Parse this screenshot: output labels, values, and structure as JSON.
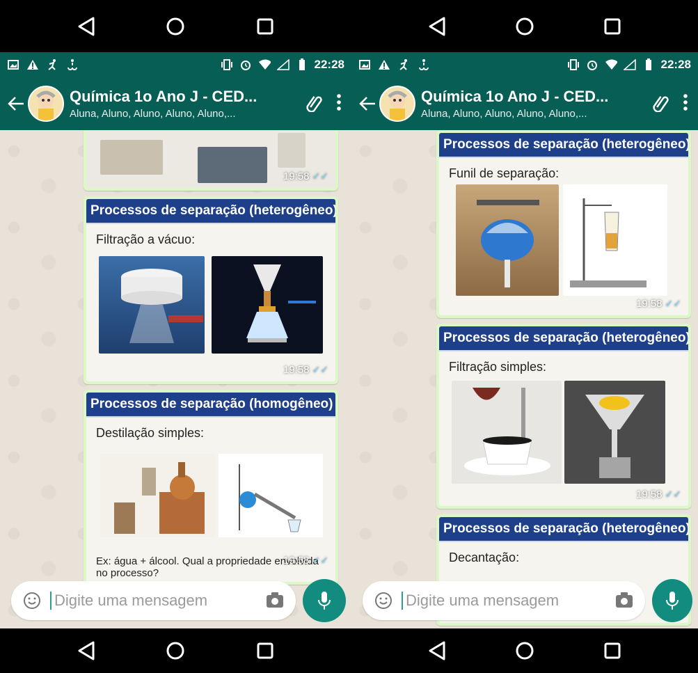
{
  "status": {
    "time": "22:28"
  },
  "header": {
    "title": "Química 1o Ano J - CED...",
    "subtitle": "Aluna, Aluno, Aluno, Aluno, Aluno,..."
  },
  "left": {
    "messages": [
      {
        "time": "19:58"
      },
      {
        "slide_title": "Processos de separação (heterogêneo)",
        "slide_sub": "Filtração a vácuo:",
        "time": "19:58"
      },
      {
        "slide_title": "Processos de separação (homogêneo)",
        "slide_sub": "Destilação simples:",
        "slide_foot": "Ex: água + álcool. Qual a propriedade envolvida no processo?",
        "time": "19:58"
      }
    ]
  },
  "right": {
    "messages": [
      {
        "slide_title": "Processos de separação (heterogêneo)",
        "slide_sub": "Funil de separação:",
        "time": "19:58"
      },
      {
        "slide_title": "Processos de separação (heterogêneo)",
        "slide_sub": "Filtração simples:",
        "time": "19:58"
      },
      {
        "slide_title": "Processos de separação (heterogêneo)",
        "slide_sub": "Decantação:"
      }
    ]
  },
  "composer": {
    "placeholder": "Digite uma mensagem"
  },
  "colors": {
    "appbar": "#075e54",
    "bubble": "#dcf8c6",
    "slide_header": "#1e3f8a",
    "mic": "#128c7e"
  }
}
